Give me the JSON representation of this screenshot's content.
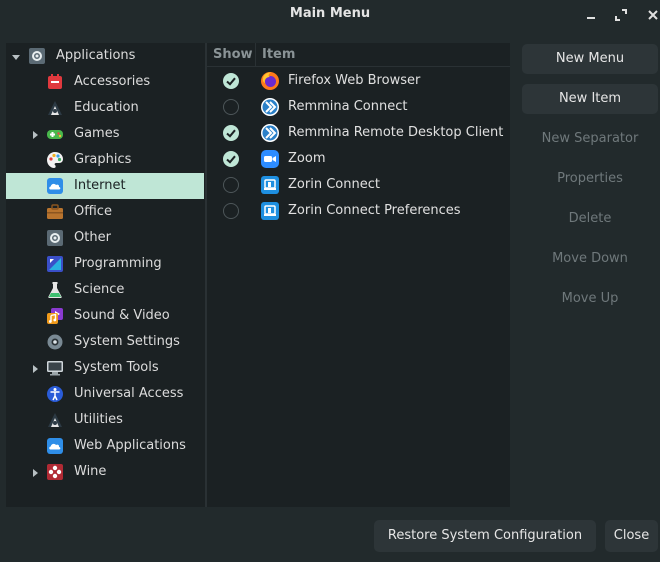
{
  "window": {
    "title": "Main Menu"
  },
  "tree": {
    "root": {
      "label": "Applications"
    },
    "items": [
      {
        "label": "Accessories",
        "icon": "accessories-icon"
      },
      {
        "label": "Education",
        "icon": "education-icon"
      },
      {
        "label": "Games",
        "icon": "games-icon"
      },
      {
        "label": "Graphics",
        "icon": "graphics-icon"
      },
      {
        "label": "Internet",
        "icon": "internet-icon"
      },
      {
        "label": "Office",
        "icon": "office-icon"
      },
      {
        "label": "Other",
        "icon": "other-icon"
      },
      {
        "label": "Programming",
        "icon": "programming-icon"
      },
      {
        "label": "Science",
        "icon": "science-icon"
      },
      {
        "label": "Sound & Video",
        "icon": "sound-video-icon"
      },
      {
        "label": "System Settings",
        "icon": "system-settings-icon"
      },
      {
        "label": "System Tools",
        "icon": "system-tools-icon"
      },
      {
        "label": "Universal Access",
        "icon": "universal-access-icon"
      },
      {
        "label": "Utilities",
        "icon": "utilities-icon"
      },
      {
        "label": "Web Applications",
        "icon": "web-applications-icon"
      },
      {
        "label": "Wine",
        "icon": "wine-icon"
      }
    ],
    "selected": "Internet"
  },
  "list": {
    "headers": {
      "show": "Show",
      "item": "Item"
    },
    "items": [
      {
        "label": "Firefox Web Browser",
        "show": true,
        "icon": "firefox-icon"
      },
      {
        "label": "Remmina Connect",
        "show": false,
        "icon": "remmina-icon"
      },
      {
        "label": "Remmina Remote Desktop Client",
        "show": true,
        "icon": "remmina-icon"
      },
      {
        "label": "Zoom",
        "show": true,
        "icon": "zoom-icon"
      },
      {
        "label": "Zorin Connect",
        "show": false,
        "icon": "zorin-connect-icon"
      },
      {
        "label": "Zorin Connect Preferences",
        "show": false,
        "icon": "zorin-connect-icon"
      }
    ]
  },
  "actions": {
    "new_menu": "New Menu",
    "new_item": "New Item",
    "new_separator": "New Separator",
    "properties": "Properties",
    "delete": "Delete",
    "move_down": "Move Down",
    "move_up": "Move Up"
  },
  "footer": {
    "restore": "Restore System Configuration",
    "close": "Close"
  },
  "colors": {
    "background": "#222a2c",
    "panel": "#1b2123",
    "selection": "#bfe6d6",
    "disabled_text": "#6f787b"
  }
}
